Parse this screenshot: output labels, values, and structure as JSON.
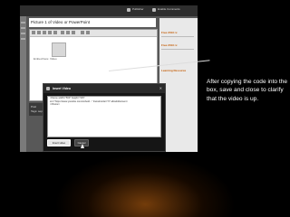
{
  "screenshot": {
    "topbar": {
      "publisher_label": "Publisher",
      "comments_label": "Enable Comments"
    },
    "post_title": "Picture 1 of Video or PowerPoint",
    "embed_caption": "Embed here: Video",
    "sidebar": {
      "items": [
        "Free 2013 rc",
        "Free 2013 rc",
        "Learning Resource"
      ]
    },
    "tags": {
      "line1": "Post",
      "line2": "Tags: separate with commas"
    }
  },
  "dialog": {
    "title": "Insert Video",
    "close_glyph": "✕",
    "code_lines": [
      "<iframe width=\"560\" height=\"315\"",
      "src=\"https://www.youtube.com/embed/...\" frameborder=\"0\" allowfullscreen>",
      "</iframe>"
    ],
    "insert_label": "Insert video",
    "cancel_label": "Cancel"
  },
  "annotation": {
    "text": "After copying the code into the box, save and close to clarify that the video is up."
  }
}
